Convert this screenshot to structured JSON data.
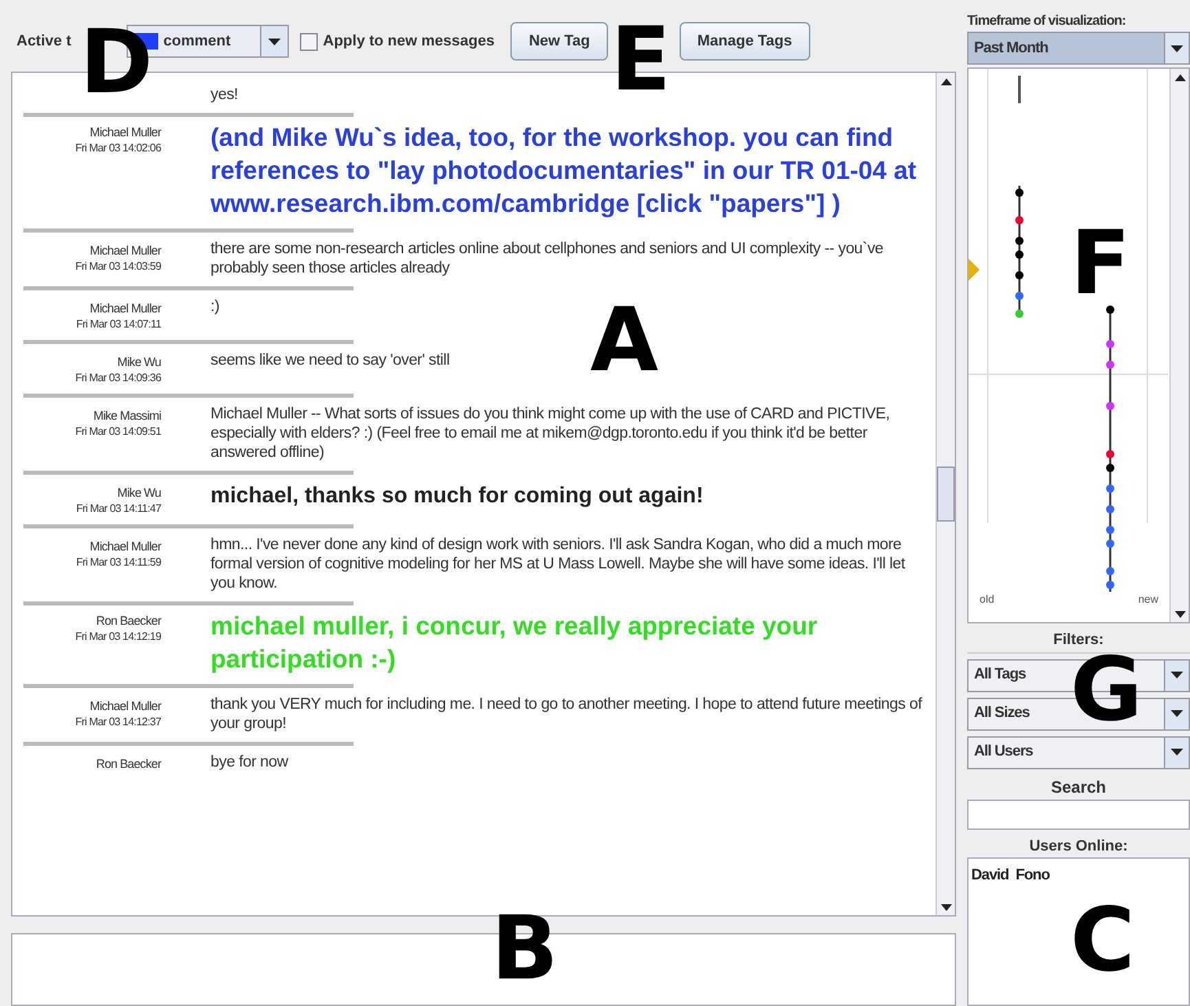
{
  "toolbar": {
    "active_tag_label": "Active t",
    "tag_dropdown": {
      "value": "comment",
      "color": "#1f3fff"
    },
    "apply_checkbox": {
      "label": "Apply to new messages",
      "checked": false
    },
    "buttons": [
      "New Tag",
      "Manage Tags"
    ]
  },
  "messages": [
    {
      "text": "yes!",
      "kind": "plain"
    },
    {
      "author": "Michael Muller",
      "time": "Fri Mar 03 14:02:06",
      "text": "(and Mike Wu`s idea, too, for the workshop.  you can find references to \"lay photodocumentaries\" in our TR 01-04 at www.research.ibm.com/cambridge [click \"papers\"] )",
      "kind": "highlight",
      "color": "#2a3fe0"
    },
    {
      "author": "Michael Muller",
      "time": "Fri Mar 03 14:03:59",
      "text": "there are some non-research articles online about cellphones and seniors and UI complexity -- you`ve probably seen those articles already",
      "kind": "plain"
    },
    {
      "author": "Michael Muller",
      "time": "Fri Mar 03 14:07:11",
      "text": ":)",
      "kind": "plain"
    },
    {
      "author": "Mike Wu",
      "time": "Fri Mar 03 14:09:36",
      "text": "seems like we need to say 'over' still",
      "kind": "plain"
    },
    {
      "author": "Mike Massimi",
      "time": "Fri Mar 03 14:09:51",
      "text": "Michael Muller -- What sorts of issues do you think might come up with the use of CARD and PICTIVE, especially with elders? :) (Feel free to email me at mikem@dgp.toronto.edu if you think it'd be better answered offline)",
      "kind": "plain"
    },
    {
      "author": "Mike Wu",
      "time": "Fri Mar 03 14:11:47",
      "text": "michael, thanks so much for coming out again!",
      "kind": "emphasis"
    },
    {
      "author": "Michael Muller",
      "time": "Fri Mar 03 14:11:59",
      "text": "hmn... I've never done any kind of design work with seniors.  I'll ask Sandra Kogan, who did a much more formal version of cognitive modeling for her MS at U Mass Lowell.  Maybe she will have some ideas.  I'll let you know.",
      "kind": "plain"
    },
    {
      "author": "Ron Baecker",
      "time": "Fri Mar 03 14:12:19",
      "text": "michael muller, i concur, we really appreciate your participation :-)",
      "kind": "highlight",
      "color": "#33dd22"
    },
    {
      "author": "Michael Muller",
      "time": "Fri Mar 03 14:12:37",
      "text": "thank you VERY much for including me.  I need to go to another meeting.  I hope to attend future meetings of your group!",
      "kind": "plain"
    },
    {
      "author": "Ron Baecker",
      "text": "bye for now",
      "kind": "plain"
    }
  ],
  "sidebar": {
    "timeframe_label": "Timeframe of visualization:",
    "timeframe": "Past Month",
    "axis_old": "old",
    "axis_new": "new",
    "filters_label": "Filters:",
    "filters": [
      "All Tags",
      "All Sizes",
      "All Users"
    ],
    "search_label": "Search",
    "users_label": "Users Online:",
    "users": [
      "David  Fono"
    ]
  },
  "annotations": [
    "D",
    "E",
    "A",
    "B",
    "F",
    "G",
    "C"
  ]
}
